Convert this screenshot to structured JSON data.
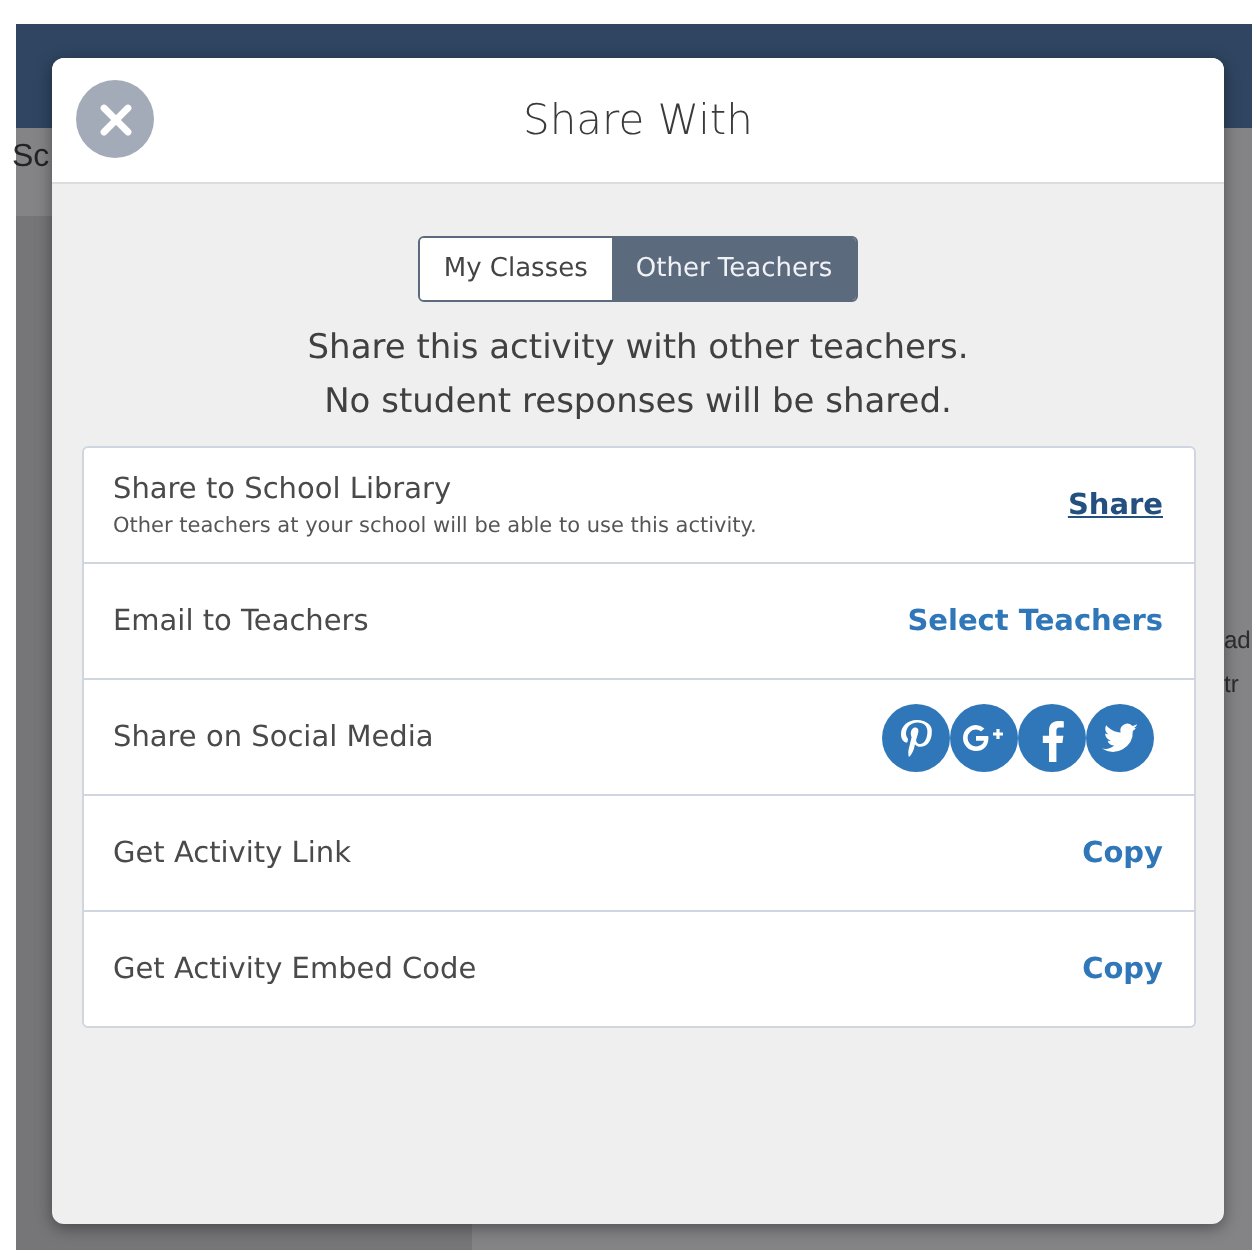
{
  "background": {
    "left_texts": [
      "Sc"
    ],
    "right_texts": [
      "ad",
      "tr"
    ]
  },
  "dialog": {
    "title": "Share With",
    "toggle": [
      {
        "label": "My Classes",
        "selected": false
      },
      {
        "label": "Other Teachers",
        "selected": true
      }
    ],
    "message": [
      "Share this activity with other teachers.",
      "No student responses will be shared."
    ],
    "options": [
      {
        "kind": "link",
        "label": "Share to School Library",
        "description": "Other teachers at your school will be able to use this activity.",
        "action": "Share",
        "underlined": true
      },
      {
        "kind": "link",
        "label": "Email to Teachers",
        "action": "Select Teachers",
        "underlined": false
      },
      {
        "kind": "social",
        "label": "Share on Social Media"
      },
      {
        "kind": "link",
        "label": "Get Activity Link",
        "action": "Copy",
        "underlined": false
      },
      {
        "kind": "link",
        "label": "Get Activity Embed Code",
        "action": "Copy",
        "underlined": false
      }
    ]
  }
}
